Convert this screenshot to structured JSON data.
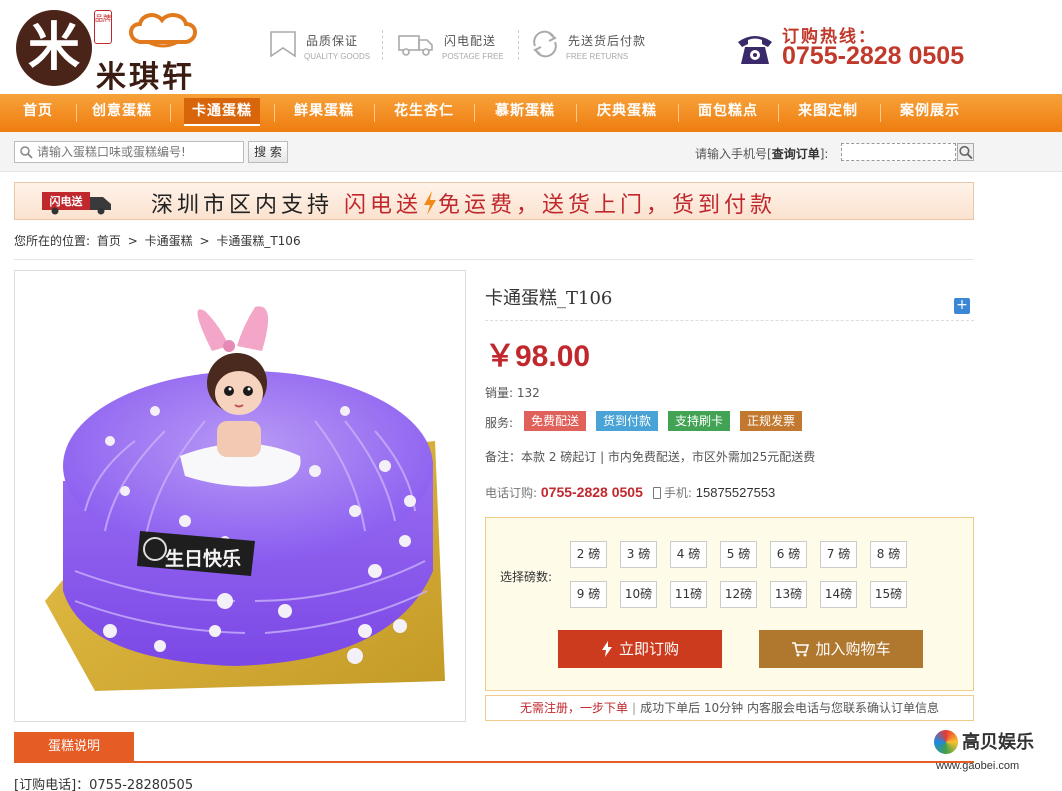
{
  "brand": {
    "name": "米琪轩",
    "seal": "品牌",
    "mark": "米"
  },
  "promises": [
    {
      "title": "品质保证",
      "subtitle": "QUALITY GOODS",
      "icon": "bookmark-icon"
    },
    {
      "title": "闪电配送",
      "subtitle": "POSTAGE FREE",
      "icon": "truck-icon"
    },
    {
      "title": "先送货后付款",
      "subtitle": "FREE RETURNS",
      "icon": "return-arrows-icon"
    }
  ],
  "hotline": {
    "label": "订购热线：",
    "number": "0755-2828 0505",
    "icon": "telephone-icon"
  },
  "nav": {
    "items": [
      "首页",
      "创意蛋糕",
      "卡通蛋糕",
      "鲜果蛋糕",
      "花生杏仁",
      "慕斯蛋糕",
      "庆典蛋糕",
      "面包糕点",
      "来图定制",
      "案例展示"
    ],
    "active": "卡通蛋糕"
  },
  "search": {
    "placeholder": "请输入蛋糕口味或蛋糕编号!",
    "button": "搜 索",
    "order_label_prefix": "请输入手机号[",
    "order_label_bold": "查询订单",
    "order_label_suffix": "]:"
  },
  "banner": {
    "badge": "闪电送",
    "text_black": "深圳市区内支持",
    "text_red": "闪电送",
    "text_after": "免运费，送货上门，货到付款"
  },
  "breadcrumb": {
    "prefix": "您所在的位置:",
    "items": [
      "首页",
      "卡通蛋糕",
      "卡通蛋糕_T106"
    ],
    "separator": ">"
  },
  "product": {
    "title": "卡通蛋糕_T106",
    "price": "￥98.00",
    "sales_label": "销量:",
    "sales_value": "132",
    "service_label": "服务:",
    "services": [
      {
        "label": "免费配送",
        "color": "#e0605a"
      },
      {
        "label": "货到付款",
        "color": "#4aa3d6"
      },
      {
        "label": "支持刷卡",
        "color": "#43a355"
      },
      {
        "label": "正规发票",
        "color": "#c2782f"
      }
    ],
    "note": "备注：本款 2 磅起订 | 市内免费配送，市区外需加25元配送费",
    "phone_label": "电话订购:",
    "phone": "0755-2828 0505",
    "mobile_label": "手机:",
    "mobile": "15875527553",
    "cake_topper": "生日快乐"
  },
  "buy": {
    "size_label": "选择磅数:",
    "sizes": [
      "2 磅",
      "3 磅",
      "4 磅",
      "5 磅",
      "6 磅",
      "7 磅",
      "8 磅",
      "9 磅",
      "10磅",
      "11磅",
      "12磅",
      "13磅",
      "14磅",
      "15磅"
    ],
    "buy_now": "立即订购",
    "add_cart": "加入购物车",
    "footer_red": "无需注册，一步下单",
    "footer_sep": "|",
    "footer_rest": "成功下单后 10分钟 内客服会电话与您联系确认订单信息"
  },
  "tabs": {
    "active": "蛋糕说明"
  },
  "order_tel": "[订购电话]：0755-28280505",
  "watermark": {
    "name": "高贝娱乐",
    "url": "www.gaobei.com"
  },
  "colors": {
    "nav": "#ef8a1f",
    "price": "#c0282d",
    "accent": "#e65c25"
  }
}
